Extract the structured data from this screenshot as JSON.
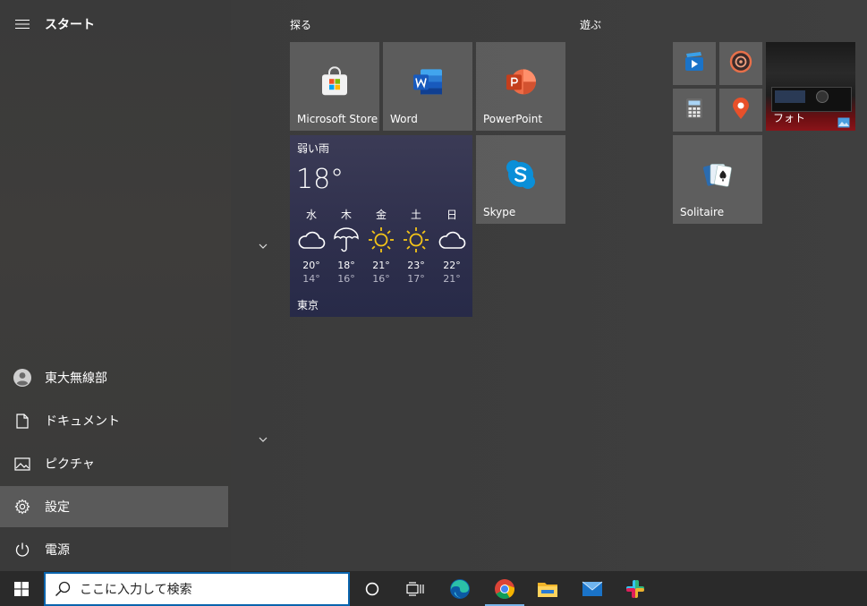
{
  "start": {
    "title": "スタート",
    "sidebar": {
      "user": "東大無線部",
      "documents": "ドキュメント",
      "pictures": "ピクチャ",
      "settings": "設定",
      "power": "電源"
    },
    "groups": {
      "explore": "探る",
      "play": "遊ぶ"
    },
    "tiles": {
      "store": "Microsoft Store",
      "word": "Word",
      "powerpoint": "PowerPoint",
      "skype": "Skype",
      "solitaire": "Solitaire",
      "photos": "フォト"
    },
    "weather": {
      "condition": "弱い雨",
      "temperature": "18°",
      "city": "東京",
      "forecast": [
        {
          "day": "水",
          "icon": "cloud-icon",
          "high": "20°",
          "low": "14°"
        },
        {
          "day": "木",
          "icon": "umbrella-icon",
          "high": "18°",
          "low": "16°"
        },
        {
          "day": "金",
          "icon": "sun-icon",
          "high": "21°",
          "low": "16°"
        },
        {
          "day": "土",
          "icon": "sun-icon",
          "high": "23°",
          "low": "17°"
        },
        {
          "day": "日",
          "icon": "cloud-icon",
          "high": "22°",
          "low": "21°"
        }
      ]
    }
  },
  "taskbar": {
    "search_placeholder": "ここに入力して検索"
  },
  "colors": {
    "accent": "#0a64ad",
    "sun": "#f5c518",
    "word": "#185abd",
    "powerpoint": "#d24726",
    "skype": "#0a8fd8"
  }
}
